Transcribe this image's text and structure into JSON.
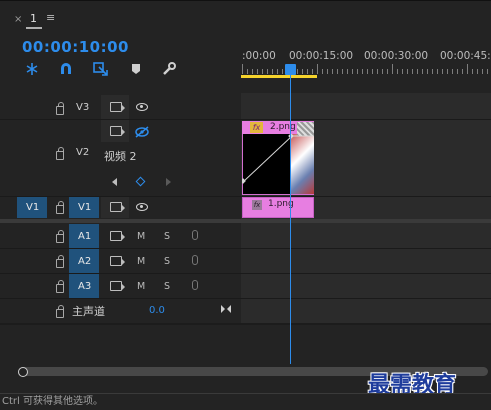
{
  "panel": {
    "close_glyph": "×",
    "sequence_name": "1",
    "menu_glyph": "≡",
    "timecode": "00:00:10:00"
  },
  "toolbar": {
    "icons": [
      "nest-sequence-icon",
      "snap-magnet-icon",
      "linked-selection-icon",
      "add-marker-icon",
      "wrench-settings-icon"
    ]
  },
  "ruler": {
    "labels": [
      ":00:00",
      "00:00:15:00",
      "00:00:30:00",
      "00:00:45:00"
    ]
  },
  "tracks": {
    "v3": {
      "label": "V3"
    },
    "v2": {
      "label": "V2",
      "name": "视频 2"
    },
    "v1": {
      "source_label": "V1",
      "label": "V1"
    },
    "a1": {
      "label": "A1",
      "m": "M",
      "s": "S"
    },
    "a2": {
      "label": "A2",
      "m": "M",
      "s": "S"
    },
    "a3": {
      "label": "A3",
      "m": "M",
      "s": "S"
    },
    "master": {
      "label": "主声道",
      "value": "0.0"
    }
  },
  "clips": {
    "v2_clip": {
      "fx": "fx",
      "name": "2.png"
    },
    "v1_clip": {
      "fx": "fx",
      "name": "1.png"
    }
  },
  "status": {
    "text": "Ctrl 可获得其他选项。"
  },
  "watermark": {
    "text": "最需教育"
  },
  "colors": {
    "accent": "#2d8ceb",
    "clip": "#e77ee1",
    "track_blue": "#20527c",
    "in_out_bar": "#f5d32c"
  }
}
